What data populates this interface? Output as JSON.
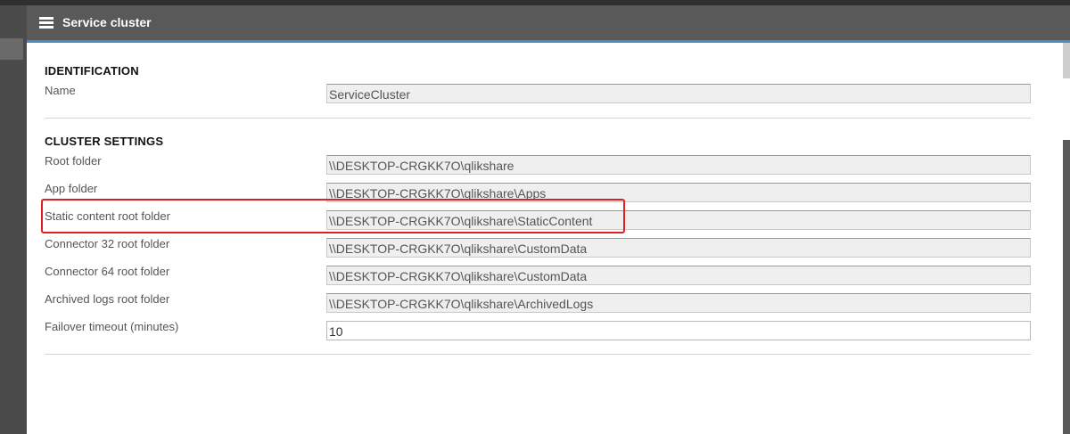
{
  "header": {
    "title": "Service cluster",
    "icon": "server-stack-icon"
  },
  "identification": {
    "heading": "IDENTIFICATION",
    "name_label": "Name",
    "name_value": "ServiceCluster"
  },
  "cluster_settings": {
    "heading": "CLUSTER SETTINGS",
    "fields": [
      {
        "label": "Root folder",
        "value": "\\\\DESKTOP-CRGKK7O\\qlikshare"
      },
      {
        "label": "App folder",
        "value": "\\\\DESKTOP-CRGKK7O\\qlikshare\\Apps"
      },
      {
        "label": "Static content root folder",
        "value": "\\\\DESKTOP-CRGKK7O\\qlikshare\\StaticContent"
      },
      {
        "label": "Connector 32 root folder",
        "value": "\\\\DESKTOP-CRGKK7O\\qlikshare\\CustomData"
      },
      {
        "label": "Connector 64 root folder",
        "value": "\\\\DESKTOP-CRGKK7O\\qlikshare\\CustomData"
      },
      {
        "label": "Archived logs root folder",
        "value": "\\\\DESKTOP-CRGKK7O\\qlikshare\\ArchivedLogs"
      },
      {
        "label": "Failover timeout (minutes)",
        "value": "10"
      }
    ]
  },
  "colors": {
    "header_bg": "#595959",
    "accent": "#4d89c5",
    "highlight": "#e02020"
  }
}
